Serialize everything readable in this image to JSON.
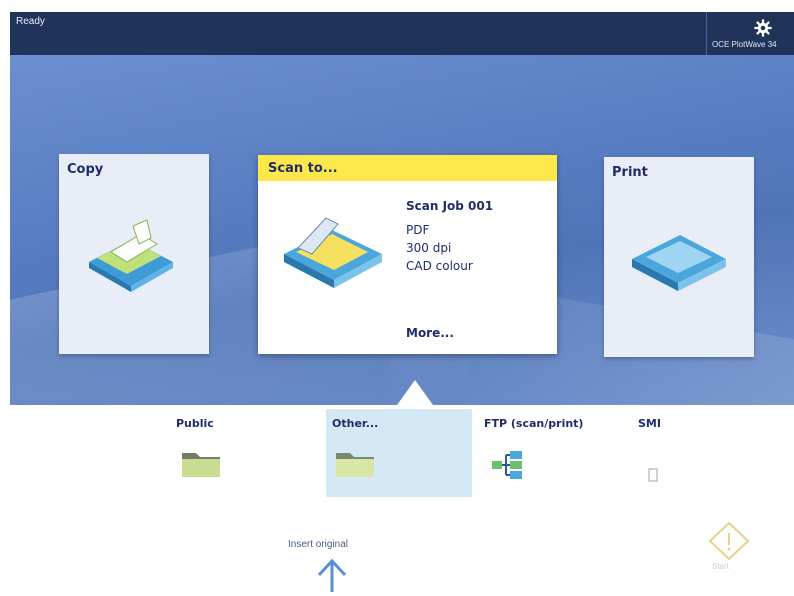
{
  "status_bar": {
    "status": "Ready",
    "device_name": "OCE PlotWave 34"
  },
  "tiles": {
    "copy": {
      "title": "Copy"
    },
    "scan": {
      "title": "Scan to...",
      "job_name": "Scan Job 001",
      "format": "PDF",
      "resolution": "300 dpi",
      "color_mode": "CAD colour",
      "more": "More..."
    },
    "print": {
      "title": "Print"
    }
  },
  "destinations": [
    {
      "label": "Public",
      "icon": "folder-icon",
      "selected": false
    },
    {
      "label": "Other...",
      "icon": "folder-icon",
      "selected": true
    },
    {
      "label": "FTP (scan/print)",
      "icon": "network-icon",
      "selected": false
    },
    {
      "label": "SMB",
      "icon": "network-icon",
      "selected": false
    }
  ],
  "footer": {
    "instruction": "Insert original",
    "start_label": "Start"
  },
  "colors": {
    "topbar": "#203359",
    "accent_yellow": "#fde84b",
    "selected_bg": "#d5e8f6",
    "text_dark_blue": "#1f2d6b"
  }
}
